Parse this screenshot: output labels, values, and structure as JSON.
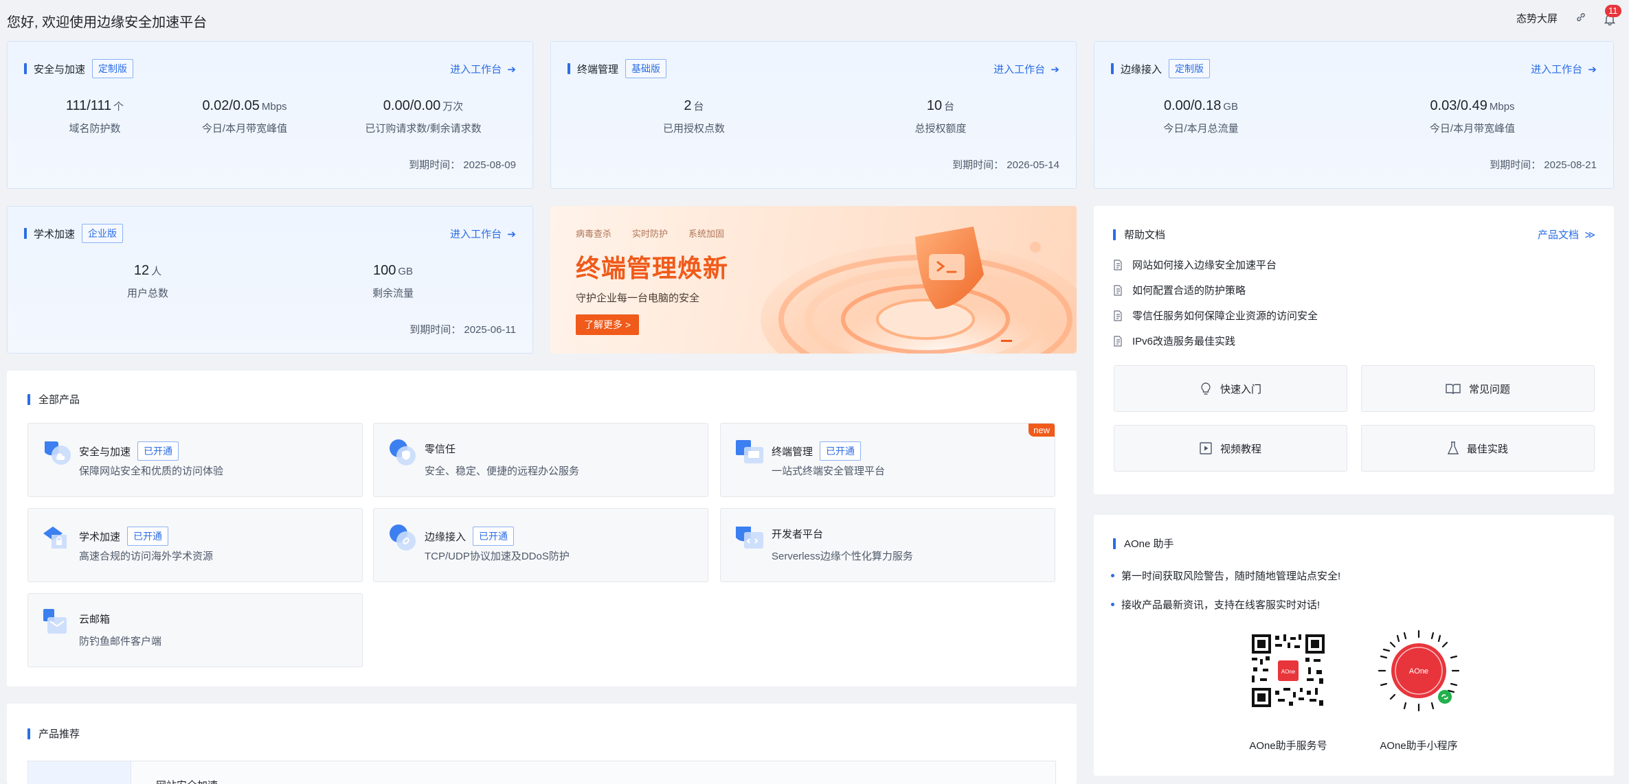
{
  "header": {
    "greeting": "您好, 欢迎使用边缘安全加速平台",
    "big_screen": "态势大屏",
    "notification_count": "11"
  },
  "services": [
    {
      "title": "安全与加速",
      "edition": "定制版",
      "enter": "进入工作台",
      "metrics": [
        {
          "value": "111/111",
          "unit": "个",
          "label": "域名防护数"
        },
        {
          "value": "0.02/0.05",
          "unit": "Mbps",
          "label": "今日/本月带宽峰值"
        },
        {
          "value": "0.00/0.00",
          "unit": "万次",
          "label": "已订购请求数/剩余请求数"
        }
      ],
      "expire": "到期时间：  2025-08-09"
    },
    {
      "title": "终端管理",
      "edition": "基础版",
      "enter": "进入工作台",
      "metrics": [
        {
          "value": "2",
          "unit": "台",
          "label": "已用授权点数"
        },
        {
          "value": "10",
          "unit": "台",
          "label": "总授权额度"
        }
      ],
      "expire": "到期时间：  2026-05-14"
    },
    {
      "title": "边缘接入",
      "edition": "定制版",
      "enter": "进入工作台",
      "metrics": [
        {
          "value": "0.00/0.18",
          "unit": "GB",
          "label": "今日/本月总流量"
        },
        {
          "value": "0.03/0.49",
          "unit": "Mbps",
          "label": "今日/本月带宽峰值"
        }
      ],
      "expire": "到期时间：  2025-08-21"
    },
    {
      "title": "学术加速",
      "edition": "企业版",
      "enter": "进入工作台",
      "metrics": [
        {
          "value": "12",
          "unit": "人",
          "label": "用户总数"
        },
        {
          "value": "100",
          "unit": "GB",
          "label": "剩余流量"
        }
      ],
      "expire": "到期时间：  2025-06-11"
    }
  ],
  "banner": {
    "tags": [
      "病毒查杀",
      "实时防护",
      "系统加固"
    ],
    "title": "终端管理焕新",
    "subtitle": "守护企业每一台电脑的安全",
    "button": "了解更多  >"
  },
  "help": {
    "title": "帮助文档",
    "docs_link": "产品文档",
    "items": [
      "网站如何接入边缘安全加速平台",
      "如何配置合适的防护策略",
      "零信任服务如何保障企业资源的访问安全",
      "IPv6改造服务最佳实践"
    ],
    "quick": [
      "快速入门",
      "常见问题",
      "视频教程",
      "最佳实践"
    ]
  },
  "products": {
    "title": "全部产品",
    "items": [
      {
        "name": "安全与加速",
        "status": "已开通",
        "desc": "保障网站安全和优质的访问体验"
      },
      {
        "name": "零信任",
        "status": "",
        "desc": "安全、稳定、便捷的远程办公服务"
      },
      {
        "name": "终端管理",
        "status": "已开通",
        "desc": "一站式终端安全管理平台",
        "badge": "new"
      },
      {
        "name": "学术加速",
        "status": "已开通",
        "desc": "高速合规的访问海外学术资源"
      },
      {
        "name": "边缘接入",
        "status": "已开通",
        "desc": "TCP/UDP协议加速及DDoS防护"
      },
      {
        "name": "开发者平台",
        "status": "",
        "desc": "Serverless边缘个性化算力服务"
      },
      {
        "name": "云邮箱",
        "status": "",
        "desc": "防钓鱼邮件客户端"
      }
    ]
  },
  "recommend": {
    "title": "产品推荐",
    "partial": "网站安全加速"
  },
  "aone": {
    "title": "AOne 助手",
    "bullets": [
      "第一时间获取风险警告，随时随地管理站点安全!",
      "接收产品最新资讯，支持在线客服实时对话!"
    ],
    "qr": [
      "AOne助手服务号",
      "AOne助手小程序"
    ],
    "logo_text": "AOne"
  },
  "colors": {
    "accent": "#2b6de5",
    "orange": "#f05a1a",
    "badge": "#e8353c"
  }
}
